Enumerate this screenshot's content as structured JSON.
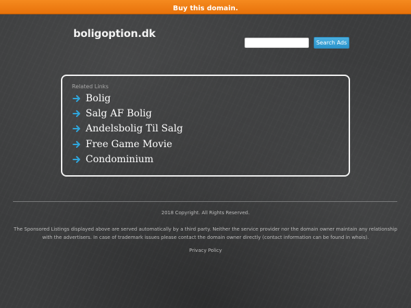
{
  "top_banner": {
    "label": "Buy this domain.",
    "color": "#f07f14"
  },
  "header": {
    "site_name": "boligoption.dk"
  },
  "search": {
    "value": "",
    "placeholder": "",
    "button_label": "Search Ads",
    "button_color": "#3aa3d8"
  },
  "related": {
    "heading": "Related Links",
    "arrow_icon": "arrow-right-icon",
    "arrow_color": "#2fa6dc",
    "items": [
      {
        "label": "Bolig"
      },
      {
        "label": "Salg AF Bolig"
      },
      {
        "label": "Andelsbolig Til Salg"
      },
      {
        "label": "Free Game Movie"
      },
      {
        "label": "Condominium"
      }
    ]
  },
  "footer": {
    "copyright": "2018 Copyright. All Rights Reserved.",
    "disclaimer": "The Sponsored Listings displayed above are served automatically by a third party. Neither the service provider nor the domain owner maintain any relationship with the advertisers. In case of trademark issues please contact the domain owner directly (contact information can be found in whois).",
    "privacy_label": "Privacy Policy"
  }
}
